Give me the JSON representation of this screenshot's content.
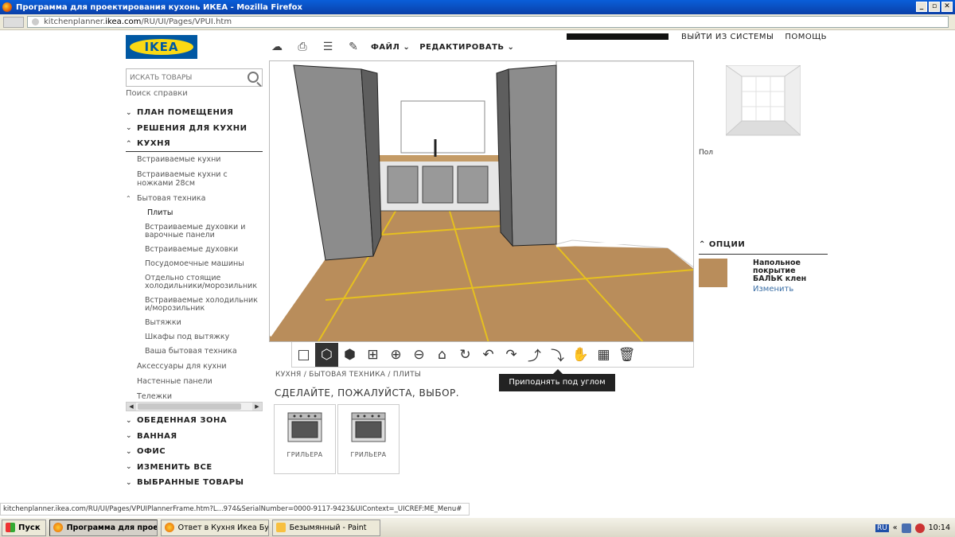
{
  "window": {
    "title": "Программа для проектирования кухонь ИКЕА - Mozilla Firefox",
    "url_prefix": "kitchenplanner.",
    "url_bold": "ikea.com",
    "url_rest": "/RU/UI/Pages/VPUI.htm",
    "buttons": [
      "_",
      "▫",
      "✕"
    ]
  },
  "logo_text": "IKEA",
  "search": {
    "placeholder": "ИСКАТЬ ТОВАРЫ"
  },
  "help_link": "Поиск справки",
  "sidebar": {
    "sections_top": [
      {
        "label": "ПЛАН ПОМЕЩЕНИЯ",
        "chev": "⌄"
      },
      {
        "label": "РЕШЕНИЯ ДЛЯ КУХНИ",
        "chev": "⌄"
      }
    ],
    "open_section": {
      "label": "КУХНЯ",
      "chev": "⌃"
    },
    "items": [
      "Встраиваемые кухни",
      "Встраиваемые кухни с ножками 28см"
    ],
    "appliances": {
      "label": "Бытовая техника",
      "chev": "⌃"
    },
    "sub_items": [
      "Плиты",
      "Встраиваемые духовки и варочные панели",
      "Встраиваемые духовки",
      "Посудомоечные машины",
      "Отдельно стоящие холодильники/морозильник",
      "Встраиваемые холодильники/морозильник",
      "Вытяжки",
      "Шкафы под вытяжку",
      "Ваша бытовая техника"
    ],
    "items_after": [
      "Аксессуары для кухни",
      "Настенные панели",
      "Тележки"
    ],
    "sections_bottom": [
      {
        "label": "ОБЕДЕННАЯ ЗОНА",
        "chev": "⌄"
      },
      {
        "label": "ВАННАЯ",
        "chev": "⌄"
      },
      {
        "label": "ОФИС",
        "chev": "⌄"
      },
      {
        "label": "ИЗМЕНИТЬ ВСЕ",
        "chev": "⌄"
      },
      {
        "label": "ВЫБРАННЫЕ ТОВАРЫ",
        "chev": "⌄"
      }
    ]
  },
  "topmenu": {
    "file": "ФАЙЛ ⌄",
    "edit": "РЕДАКТИРОВАТЬ ⌄"
  },
  "userbar": {
    "logout": "ВЫЙТИ ИЗ СИСТЕМЫ",
    "help": "ПОМОЩЬ"
  },
  "tooltip": "Приподнять под углом",
  "breadcrumb": "КУХНЯ / БЫТОВАЯ ТЕХНИКА / ПЛИТЫ",
  "choose_text": "СДЕЛАЙТЕ, ПОЖАЛУЙСТА, ВЫБОР.",
  "products": [
    {
      "label": "ГРИЛЬЕРА"
    },
    {
      "label": "ГРИЛЬЕРА"
    }
  ],
  "right_panel": {
    "floor_label": "Пол",
    "options_title": "ОПЦИИ",
    "options_chev": "⌃",
    "floor_name": "Напольное покрытие БАЛЬК клен",
    "change": "Изменить"
  },
  "statusbar": "kitchenplanner.ikea.com/RU/UI/Pages/VPUIPlannerFrame.htm?L...974&SerialNumber=0000-9117-9423&UIContext=_UICREF:ME_Menu#",
  "taskbar": {
    "start": "Пуск",
    "tasks": [
      "Программа для прое...",
      "Ответ в Кухня Икеа Бу...",
      "Безымянный - Paint"
    ],
    "lang": "RU",
    "tray_arrows": "«",
    "time": "10:14"
  },
  "colors": {
    "floor": "#b98d5b",
    "floor_lines": "#e6c01f",
    "ikea_blue": "#0058a3",
    "ikea_yellow": "#fbd914"
  }
}
